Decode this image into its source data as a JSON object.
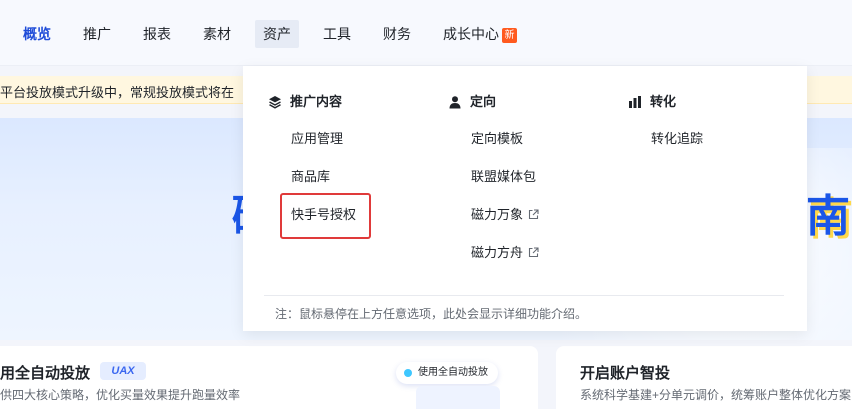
{
  "nav": {
    "items": [
      {
        "label": "概览"
      },
      {
        "label": "推广"
      },
      {
        "label": "报表"
      },
      {
        "label": "素材"
      },
      {
        "label": "资产"
      },
      {
        "label": "工具"
      },
      {
        "label": "财务"
      },
      {
        "label": "成长中心"
      }
    ],
    "badge": "新",
    "accent_color": "#1f4cd8"
  },
  "notice": {
    "text": "平台投放模式升级中，常规投放模式将在"
  },
  "hero": {
    "left_char": "磁",
    "right_char": "南"
  },
  "cards": {
    "left": {
      "title": "用全自动投放",
      "tag": "UAX",
      "desc": "供四大核心策略，优化买量效果提升跑量效率",
      "pill": "使用全自动投放"
    },
    "right": {
      "title": "开启账户智投",
      "desc": "系统科学基建+分单元调价，统筹账户整体优化方案"
    }
  },
  "dropdown": {
    "columns": [
      {
        "icon": "layers-icon",
        "title": "推广内容",
        "items": [
          {
            "label": "应用管理"
          },
          {
            "label": "商品库"
          },
          {
            "label": "快手号授权"
          }
        ]
      },
      {
        "icon": "person-icon",
        "title": "定向",
        "items": [
          {
            "label": "定向模板"
          },
          {
            "label": "联盟媒体包"
          },
          {
            "label": "磁力万象"
          },
          {
            "label": "磁力方舟"
          }
        ]
      },
      {
        "icon": "bar-chart-icon",
        "title": "转化",
        "items": [
          {
            "label": "转化追踪"
          }
        ]
      }
    ],
    "footnote": "注：鼠标悬停在上方任意选项，此处会显示详细功能介绍。",
    "highlight_color": "#e03a3a"
  }
}
